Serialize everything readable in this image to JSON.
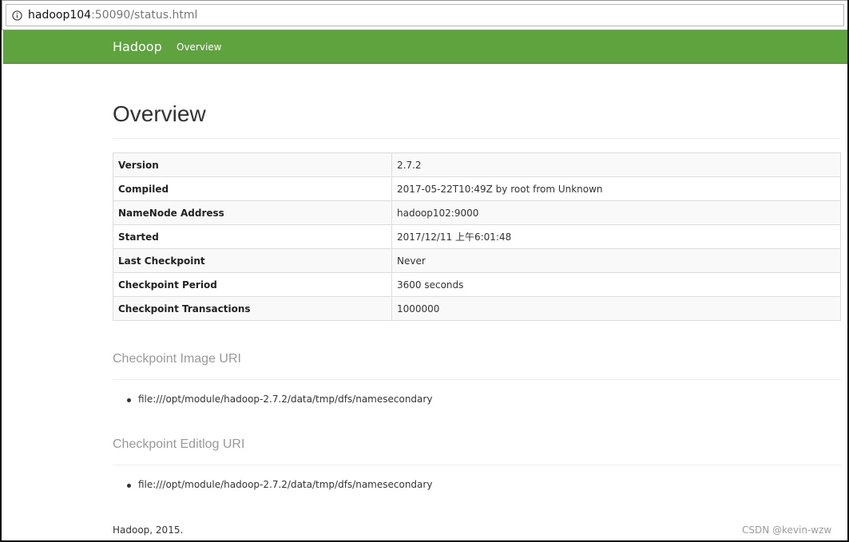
{
  "browser": {
    "url_host": "hadoop104",
    "url_rest": ":50090/status.html"
  },
  "navbar": {
    "brand": "Hadoop",
    "links": [
      "Overview"
    ]
  },
  "main": {
    "title": "Overview",
    "info_table": [
      {
        "key": "Version",
        "value": "2.7.2"
      },
      {
        "key": "Compiled",
        "value": "2017-05-22T10:49Z by root from Unknown"
      },
      {
        "key": "NameNode Address",
        "value": "hadoop102:9000"
      },
      {
        "key": "Started",
        "value": "2017/12/11 上午6:01:48"
      },
      {
        "key": "Last Checkpoint",
        "value": "Never"
      },
      {
        "key": "Checkpoint Period",
        "value": "3600 seconds"
      },
      {
        "key": "Checkpoint Transactions",
        "value": "1000000"
      }
    ],
    "image_uri_heading": "Checkpoint Image URI",
    "image_uris": [
      "file:///opt/module/hadoop-2.7.2/data/tmp/dfs/namesecondary"
    ],
    "editlog_uri_heading": "Checkpoint Editlog URI",
    "editlog_uris": [
      "file:///opt/module/hadoop-2.7.2/data/tmp/dfs/namesecondary"
    ]
  },
  "footer": {
    "text": "Hadoop, 2015."
  },
  "watermark": "CSDN @kevin-wzw",
  "colors": {
    "navbar_green": "#5fa33e",
    "heading_grey": "#999999"
  }
}
